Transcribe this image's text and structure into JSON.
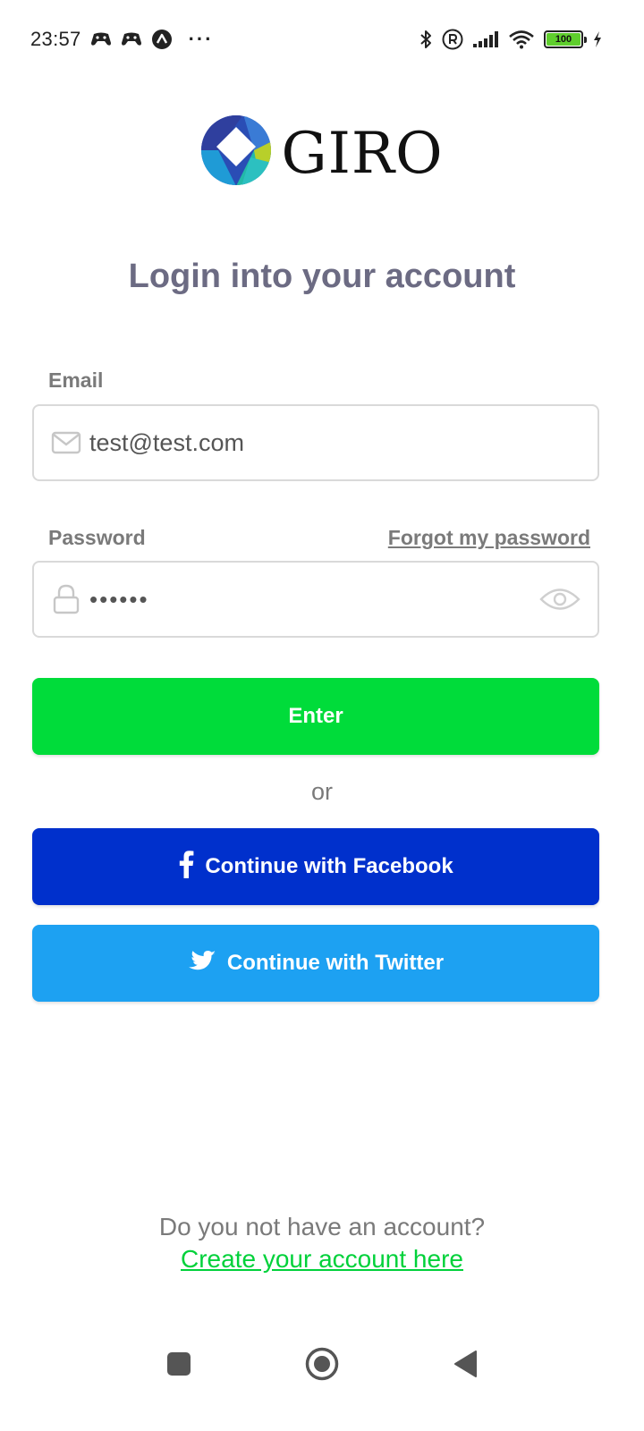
{
  "status_bar": {
    "time": "23:57",
    "notification_icons": [
      "game-controller-icon",
      "game-controller-icon",
      "arrow-up-circle-icon"
    ],
    "more_indicator": "···",
    "battery_level": "100",
    "battery_color": "#5fce2d"
  },
  "logo": {
    "text": "GIRO"
  },
  "title": "Login into your account",
  "form": {
    "email_label": "Email",
    "email_value": "test@test.com",
    "password_label": "Password",
    "password_value": "••••••",
    "forgot_label": "Forgot my password"
  },
  "buttons": {
    "enter_label": "Enter",
    "or_text": "or",
    "facebook_label": "Continue with Facebook",
    "twitter_label": "Continue with Twitter"
  },
  "footer": {
    "no_account_text": "Do you not have an account?",
    "create_link_text": "Create your account here"
  },
  "colors": {
    "primary_green": "#00dc3a",
    "facebook_blue": "#0030cc",
    "twitter_blue": "#1da1f2",
    "title_color": "#6c6b83"
  }
}
